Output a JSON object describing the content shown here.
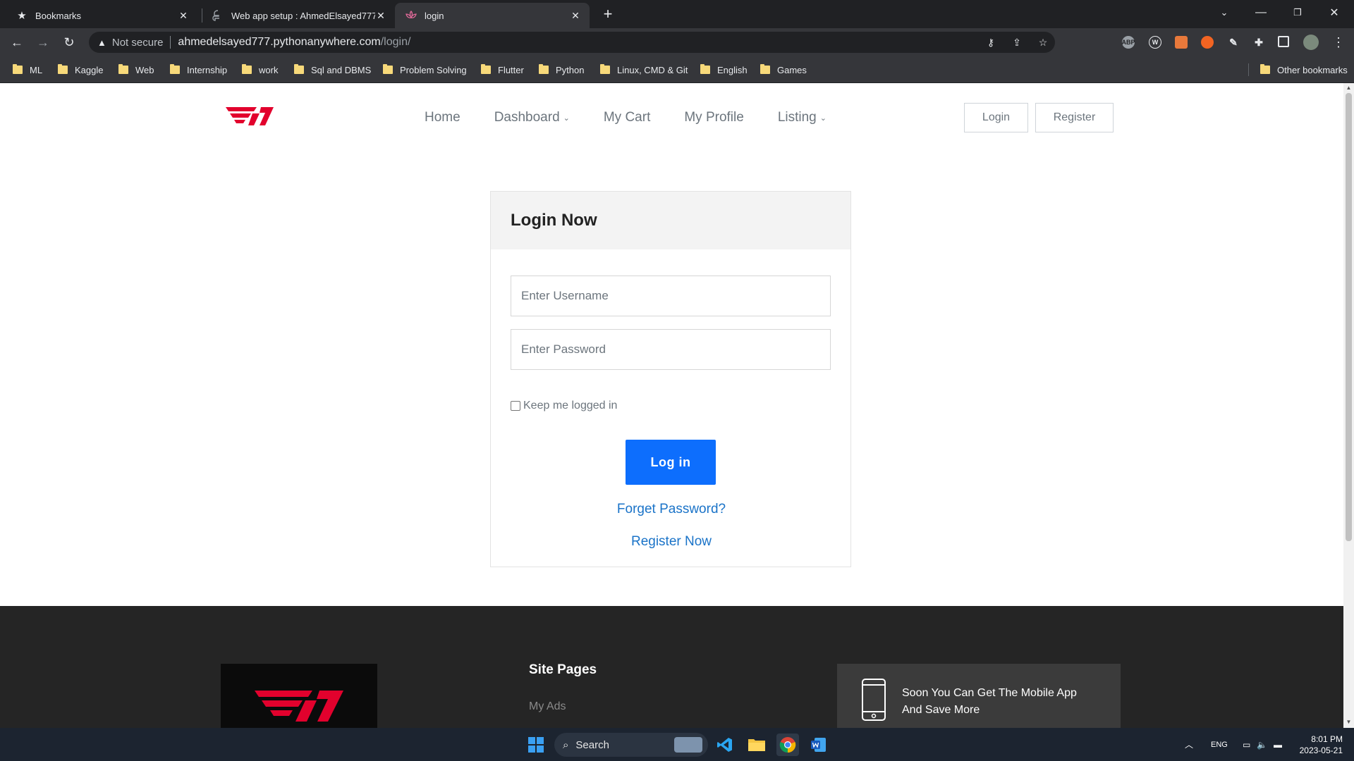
{
  "browser": {
    "tabs": [
      {
        "title": "Bookmarks",
        "icon": "star-icon",
        "active": false
      },
      {
        "title": "Web app setup : AhmedElsayed777",
        "icon": "python-icon",
        "active": false
      },
      {
        "title": "login",
        "icon": "lotus-icon",
        "active": true
      }
    ],
    "address": {
      "security_label": "Not secure",
      "host": "ahmedelsayed777.pythonanywhere.com",
      "path": "/login/"
    },
    "bookmarks": [
      "ML",
      "Kaggle",
      "Web",
      "Internship",
      "work",
      "Sql and DBMS",
      "Problem Solving",
      "Flutter",
      "Python",
      "Linux, CMD & Git",
      "English",
      "Games"
    ],
    "other_bookmarks": "Other bookmarks",
    "extensions": [
      "ABP",
      "W"
    ]
  },
  "site": {
    "brand_color": "#e2012d",
    "nav": {
      "home": "Home",
      "dashboard": "Dashboard",
      "cart": "My Cart",
      "profile": "My Profile",
      "listing": "Listing"
    },
    "header_buttons": {
      "login": "Login",
      "register": "Register"
    },
    "login_card": {
      "title": "Login Now",
      "username_placeholder": "Enter Username",
      "password_placeholder": "Enter Password",
      "remember_label": "Keep me logged in",
      "submit_label": "Log in",
      "forgot_link": "Forget Password?",
      "register_link": "Register Now"
    },
    "footer": {
      "site_pages_title": "Site Pages",
      "first_link": "My Ads",
      "app_promo_line1": "Soon You Can Get The Mobile App",
      "app_promo_line2": "And Save More"
    }
  },
  "taskbar": {
    "search_label": "Search",
    "language": "ENG",
    "time": "8:01 PM",
    "date": "2023-05-21"
  }
}
